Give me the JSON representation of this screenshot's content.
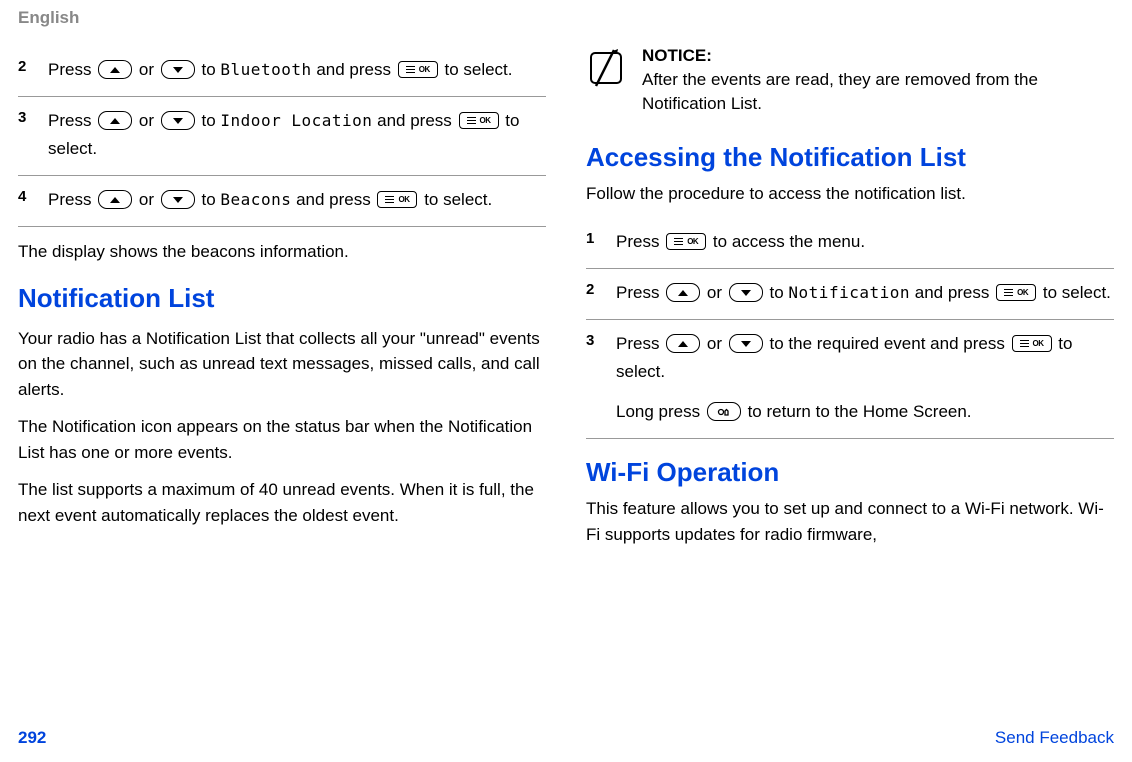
{
  "header": {
    "language": "English"
  },
  "left": {
    "steps": [
      {
        "num": "2",
        "pre": "Press ",
        "mid1": " or ",
        "target": "Bluetooth",
        "mid2": " and press ",
        "post": " to select."
      },
      {
        "num": "3",
        "pre": "Press ",
        "mid1": " or ",
        "target": "Indoor Location",
        "mid2": " and press ",
        "post": " to select."
      },
      {
        "num": "4",
        "pre": "Press ",
        "mid1": " or ",
        "target": "Beacons",
        "mid2": " and press ",
        "post": " to select."
      }
    ],
    "afterSteps": "The display shows the beacons information.",
    "section1": {
      "title": "Notification List",
      "p1": "Your radio has a Notification List that collects all your \"unread\" events on the channel, such as unread text messages, missed calls, and call alerts.",
      "p2": "The Notification icon appears on the status bar when the Notification List has one or more events.",
      "p3": "The list supports a maximum of 40 unread events. When it is full, the next event automatically replaces the oldest event."
    }
  },
  "right": {
    "notice": {
      "title": "NOTICE:",
      "text": "After the events are read, they are removed from the Notification List."
    },
    "section2": {
      "title": "Accessing the Notification List",
      "intro": "Follow the procedure to access the notification list.",
      "steps": [
        {
          "num": "1",
          "pre": "Press ",
          "post": " to access the menu."
        },
        {
          "num": "2",
          "pre": "Press ",
          "mid1": " or ",
          "target": "Notification",
          "mid2": " and press ",
          "post": " to select."
        },
        {
          "num": "3",
          "pre": "Press ",
          "mid1": " or ",
          "mid2": " to the required event and press ",
          "post": " to select.",
          "extra_pre": "Long press ",
          "extra_post": " to return to the Home Screen."
        }
      ]
    },
    "section3": {
      "title": "Wi-Fi Operation",
      "intro": "This feature allows you to set up and connect to a Wi-Fi network. Wi-Fi supports updates for radio firmware,"
    }
  },
  "footer": {
    "page": "292",
    "link": "Send Feedback"
  }
}
